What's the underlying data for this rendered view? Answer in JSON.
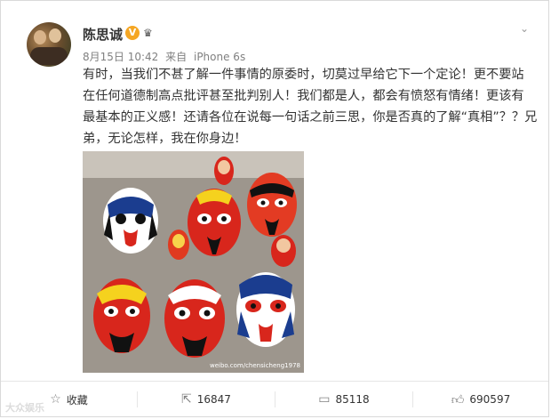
{
  "post": {
    "author": "陈思诚",
    "verified_badge": "V",
    "crown_icon": "crown-icon",
    "date": "8月15日 10:42",
    "source_prefix": "来自",
    "source": "iPhone 6s",
    "content_lines": [
      "有时，当我们不甚了解一件事情的原委时，切莫过早给它下一个定论！更不要站",
      "在任何道德制高点批评甚至批判别人！我们都是人，都会有愤怒有情绪！更该有",
      "最基本的正义感！还请各位在说每一句话之前三思，你是否真的了解“真相”？？兄",
      "弟，无论怎样，我在你身边！"
    ],
    "image_watermark": "weibo.com/chensicheng1978"
  },
  "actions": {
    "favorite_label": "收藏",
    "repost_count": "16847",
    "comment_count": "85118",
    "like_count": "690597"
  },
  "footer": {
    "brand": "大众娱乐"
  },
  "colors": {
    "text": "#333333",
    "meta": "#808080",
    "badge": "#f5a623",
    "mask_red": "#d8261c",
    "mask_blue": "#1b3d8f"
  }
}
